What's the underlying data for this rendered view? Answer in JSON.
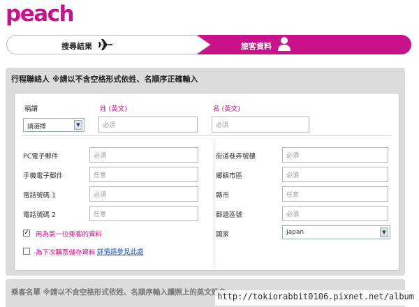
{
  "brand": {
    "logo": "peach",
    "color": "#c8128a"
  },
  "steps": [
    {
      "label": "搜尋結果",
      "icon": "airplane-icon",
      "active": false
    },
    {
      "label": "旅客資料",
      "icon": "person-icon",
      "active": true
    }
  ],
  "contact": {
    "title": "行程聯絡人 ※請以不含空格形式依姓、名順序正確輸入",
    "salutation_label": "稱謂",
    "salutation_value": "請選擇",
    "surname_label": "姓 (英文)",
    "surname_placeholder": "必須",
    "given_label": "名 (英文)",
    "given_placeholder": "必須",
    "left_fields": [
      {
        "label": "PC電子郵件",
        "placeholder": "必須"
      },
      {
        "label": "手機電子郵件",
        "placeholder": "任意"
      },
      {
        "label": "電話號碼 1",
        "placeholder": "必須"
      },
      {
        "label": "電話號碼 2",
        "placeholder": "任意"
      }
    ],
    "right_fields": [
      {
        "label": "街道巷弄號樓",
        "placeholder": "必須"
      },
      {
        "label": "鄉鎮市區",
        "placeholder": "必須"
      },
      {
        "label": "縣市",
        "placeholder": "任意"
      },
      {
        "label": "郵遞區號",
        "placeholder": "必須"
      }
    ],
    "country_label": "國家",
    "country_value": "Japan",
    "checkbox1_label": "用為第一位乘客的資料",
    "checkbox1_checked": true,
    "checkbox2_label": "為下次購票儲存資料",
    "checkbox2_checked": false,
    "details_link": "詳情請參見此處"
  },
  "passenger_section": {
    "title": "乘客名單 ※請以不含空格形式依姓、名順序輸入護照上的英文姓名"
  },
  "watermark": "http://tokiorabbit0106.pixnet.net/album"
}
